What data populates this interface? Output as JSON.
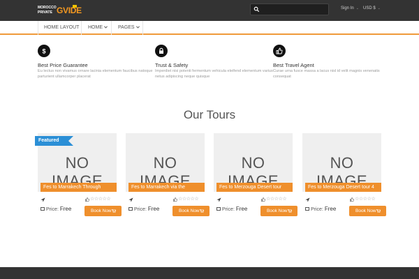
{
  "topbar": {
    "logo": {
      "line1": "MOROCCO",
      "line2": "PRIVATE",
      "big": "GVIDE"
    },
    "search": {
      "placeholder": ""
    },
    "signin_label": "Sign In",
    "currency_label": "USD $"
  },
  "nav": {
    "items": [
      {
        "label": "HOME LAYOUT"
      },
      {
        "label": "HOME"
      },
      {
        "label": "PAGES"
      }
    ]
  },
  "features": [
    {
      "icon": "dollar-icon",
      "title": "Best Price Guarantee",
      "text": "Eu lectus non vivamus ornare lacinia elementum faucibus natoque parturient ullamcorper placerat"
    },
    {
      "icon": "lock-icon",
      "title": "Trust & Safety",
      "text": "Imperdiet nisi potenti fermentum vehicula eleifend elementum varius netus adipiscing neque quisque"
    },
    {
      "icon": "thumbs-up-icon",
      "title": "Best Travel Agent",
      "text": "Curae urna fusce massa a lacus nisl id velit magnis venenatis consequat"
    }
  ],
  "section_title": "Our Tours",
  "featured_label": "Featured",
  "tours": [
    {
      "image_text": "NO IMAGE",
      "caption": "Fes to Marrakech Through",
      "stars": "☆☆☆☆☆",
      "price_label": "Price:",
      "price": "Free",
      "book_label": "Book Now"
    },
    {
      "image_text": "NO IMAGE",
      "caption": "Fes to Marrakech via the",
      "stars": "☆☆☆☆☆",
      "price_label": "Price:",
      "price": "Free",
      "book_label": "Book Now"
    },
    {
      "image_text": "NO IMAGE",
      "caption": "Fes to Merzouga Desert tour",
      "stars": "☆☆☆☆☆",
      "price_label": "Price:",
      "price": "Free",
      "book_label": "Book Now"
    },
    {
      "image_text": "NO IMAGE",
      "caption": "Fes to Merzouga Desert tour 4",
      "stars": "☆☆☆☆☆",
      "price_label": "Price:",
      "price": "Free",
      "book_label": "Book Now"
    }
  ],
  "colors": {
    "accent": "#ef8f2c",
    "featured": "#2b8fd6",
    "topbar": "#333333"
  }
}
